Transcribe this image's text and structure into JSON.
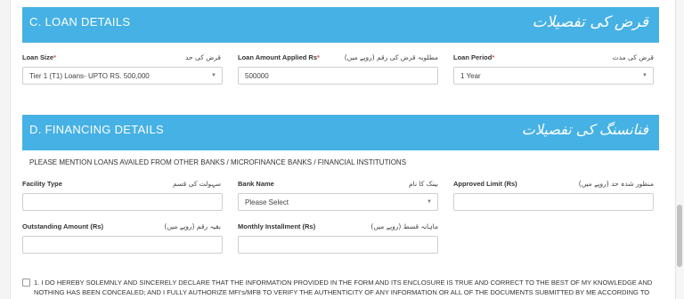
{
  "section_c": {
    "title": "C. LOAN DETAILS",
    "title_ur": "قرض کی تفصیلات",
    "loan_size": {
      "label": "Loan Size",
      "label_ur": "قرض کی حد",
      "value": "Tier 1 (T1) Loans- UPTO RS. 500,000"
    },
    "loan_amount": {
      "label": "Loan Amount Applied Rs",
      "label_ur": "مطلوبہ قرض کی رقم (روپے میں)",
      "value": "500000"
    },
    "loan_period": {
      "label": "Loan Period",
      "label_ur": "قرض کی مدت",
      "value": "1 Year"
    }
  },
  "section_d": {
    "title": "D. FINANCING DETAILS",
    "title_ur": "فنانسنگ کی تفصیلات",
    "note": "PLEASE MENTION LOANS AVAILED FROM OTHER BANKS / MICROFINANCE BANKS / FINANCIAL INSTITUTIONS",
    "facility_type": {
      "label": "Facility Type",
      "label_ur": "سہولت کی قسم",
      "value": ""
    },
    "bank_name": {
      "label": "Bank Name",
      "label_ur": "بینک کا نام",
      "value": "Please Select"
    },
    "approved_limit": {
      "label": "Approved Limit (Rs)",
      "label_ur": "منظور شدہ حد (روپے میں)",
      "value": ""
    },
    "outstanding_amount": {
      "label": "Outstanding Amount (Rs)",
      "label_ur": "بقیہ رقم (روپے میں)",
      "value": ""
    },
    "monthly_installment": {
      "label": "Monthly Installment (Rs)",
      "label_ur": "ماہانہ قسط (روپے میں)",
      "value": ""
    }
  },
  "declaration": {
    "text": "1. I DO HEREBY SOLEMNLY AND SINCERELY DECLARE THAT THE INFORMATION PROVIDED IN THE FORM AND ITS ENCLOSURE IS TRUE AND CORRECT TO THE BEST OF MY KNOWLEDGE AND NOTHING HAS BEEN CONCEALED; AND I FULLY AUTHORIZE MFI's/MFB TO VERIFY THE AUTHENTICITY OF ANY INFORMATION OR ALL OF THE DOCUMENTS SUBMITTED BY ME ACCORDING TO",
    "checked": false
  },
  "colors": {
    "header_bg": "#46b1e4",
    "required": "#d9534f"
  }
}
